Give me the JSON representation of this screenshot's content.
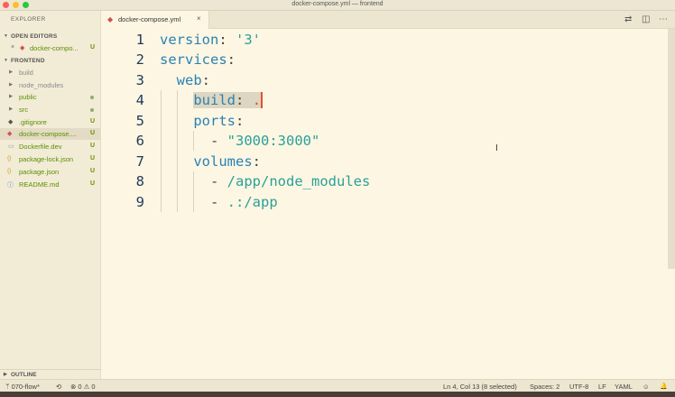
{
  "window": {
    "title": "docker-compose.yml — frontend"
  },
  "sidebar": {
    "title": "EXPLORER",
    "open_editors": {
      "header": "OPEN EDITORS",
      "items": [
        {
          "close": "×",
          "name": "docker-compo...",
          "badge": "U"
        }
      ]
    },
    "folder": {
      "header": "FRONTEND",
      "items": [
        {
          "name": "build",
          "status": ""
        },
        {
          "name": "node_modules",
          "status": ""
        },
        {
          "name": "public",
          "status": "dot"
        },
        {
          "name": "src",
          "status": "dot"
        },
        {
          "name": ".gitignore",
          "badge": "U"
        },
        {
          "name": "docker-compose....",
          "badge": "U"
        },
        {
          "name": "Dockerfile.dev",
          "badge": "U"
        },
        {
          "name": "package-lock.json",
          "badge": "U"
        },
        {
          "name": "package.json",
          "badge": "U"
        },
        {
          "name": "README.md",
          "badge": "U"
        }
      ]
    },
    "outline": "OUTLINE"
  },
  "tabs": [
    {
      "name": "docker-compose.yml",
      "close": "×"
    }
  ],
  "editor": {
    "line_numbers": [
      "1",
      "2",
      "3",
      "4",
      "5",
      "6",
      "7",
      "8",
      "9"
    ],
    "lines": {
      "l1_key": "version",
      "l1_colon": ":",
      "l1_val": " '3'",
      "l2_key": "services",
      "l2_colon": ":",
      "l3_key": "web",
      "l3_colon": ":",
      "l4_key": "build",
      "l4_colon": ":",
      "l4_val": ".",
      "l5_key": "ports",
      "l5_colon": ":",
      "l6_dash": "- ",
      "l6_val": "\"3000:3000\"",
      "l7_key": "volumes",
      "l7_colon": ":",
      "l8_dash": "- ",
      "l8_val": "/app/node_modules",
      "l9_dash": "- ",
      "l9_val": ".:/app"
    }
  },
  "statusbar": {
    "branch": "070-flow*",
    "sync": "⟲",
    "problems": "⊗ 0 ⚠ 0",
    "position": "Ln 4, Col 13 (8 selected)",
    "spaces": "Spaces: 2",
    "encoding": "UTF-8",
    "eol": "LF",
    "language": "YAML",
    "feedback": "☺",
    "notifications": "🔔"
  },
  "colors": {
    "editor_bg": "#fdf6e3",
    "sidebar_bg": "#f2ebd6",
    "untracked_badge": "#6b8f00"
  }
}
